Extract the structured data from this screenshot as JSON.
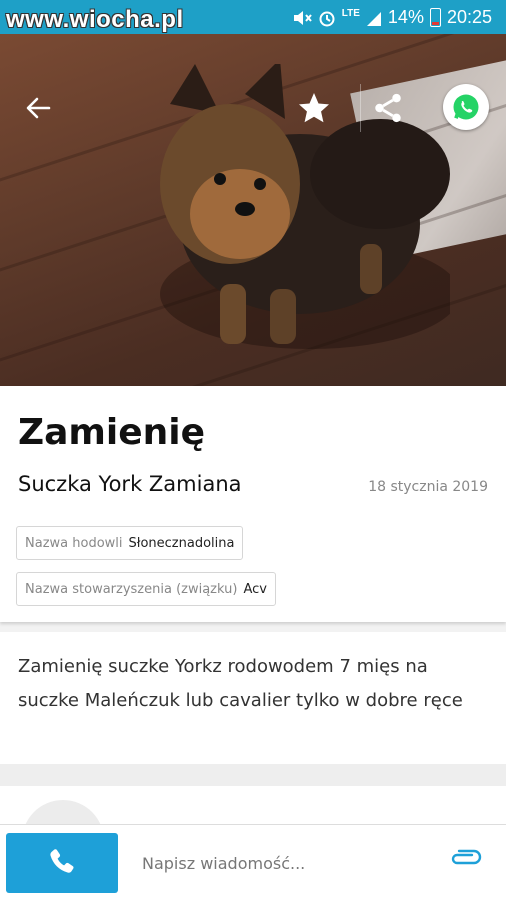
{
  "status_bar": {
    "watermark": "www.wiocha.pl",
    "network": "LTE",
    "battery": "14%",
    "time": "20:25"
  },
  "listing": {
    "title": "Zamienię",
    "subtitle": "Suczka York Zamiana",
    "date": "18 stycznia 2019",
    "attributes": [
      {
        "key": "Nazwa hodowli",
        "value": "Słonecznadolina"
      },
      {
        "key": "Nazwa stowarzyszenia (związku)",
        "value": "Acv"
      }
    ],
    "description": "Zamienię suczke Yorkz rodowodem 7 mięs na suczke Maleńczuk lub cavalier tylko w dobre ręce"
  },
  "bottom_bar": {
    "message_placeholder": "Napisz wiadomość..."
  },
  "colors": {
    "accent": "#1ea0d8",
    "whatsapp": "#25d366"
  }
}
